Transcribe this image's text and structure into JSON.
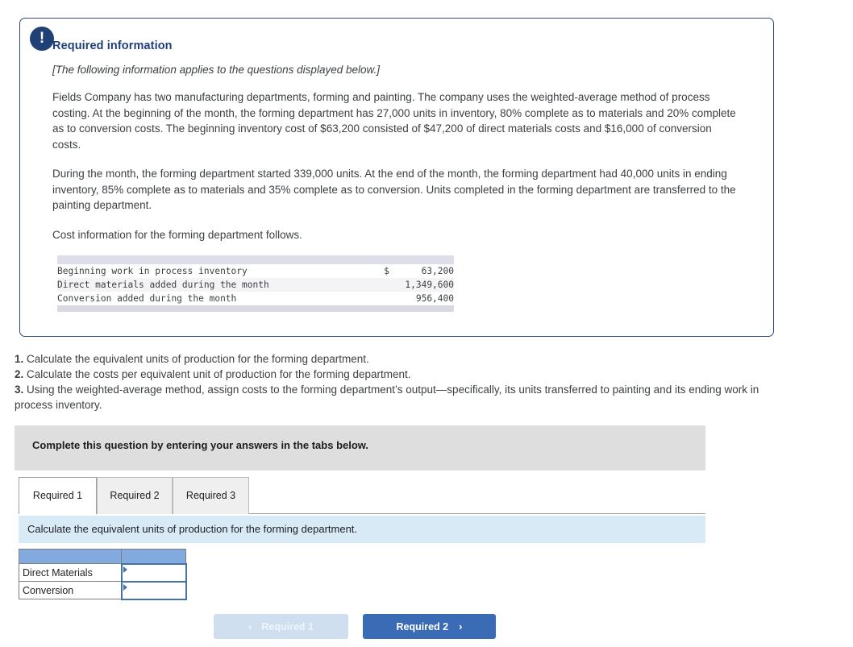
{
  "panel": {
    "alert_icon": "exclamation-icon",
    "alert_glyph": "!",
    "title": "Required information",
    "italic_note": "[The following information applies to the questions displayed below.]",
    "paragraph_1": "Fields Company has two manufacturing departments, forming and painting. The company uses the weighted-average method of process costing. At the beginning of the month, the forming department has 27,000 units in inventory, 80% complete as to materials and 20% complete as to conversion costs. The beginning inventory cost of $63,200 consisted of $47,200 of direct materials costs and $16,000 of conversion costs.",
    "paragraph_2": "During the month, the forming department started 339,000 units. At the end of the month, the forming department had 40,000 units in ending inventory, 85% complete as to materials and 35% complete as to conversion. Units completed in the forming department are transferred to the painting department.",
    "paragraph_3": "Cost information for the forming department follows."
  },
  "cost_table": {
    "rows": [
      {
        "label": "Beginning work in process inventory",
        "currency": "$",
        "amount": "63,200"
      },
      {
        "label": "Direct materials added during the month",
        "currency": "",
        "amount": "1,349,600"
      },
      {
        "label": "Conversion added during the month",
        "currency": "",
        "amount": "956,400"
      }
    ]
  },
  "requirements": [
    {
      "num": "1.",
      "text": " Calculate the equivalent units of production for the forming department."
    },
    {
      "num": "2.",
      "text": " Calculate the costs per equivalent unit of production for the forming department."
    },
    {
      "num": "3.",
      "text": " Using the weighted-average method, assign costs to the forming department’s output—specifically, its units transferred to painting and its ending work in process inventory."
    }
  ],
  "complete_bar": {
    "text": "Complete this question by entering your answers in the tabs below."
  },
  "tabs": [
    {
      "label": "Required 1",
      "active": true
    },
    {
      "label": "Required 2",
      "active": false
    },
    {
      "label": "Required 3",
      "active": false
    }
  ],
  "instruction": {
    "text": "Calculate the equivalent units of production for the forming department."
  },
  "answer_table": {
    "header": [
      "",
      ""
    ],
    "rows": [
      {
        "label": "Direct Materials",
        "value": ""
      },
      {
        "label": "Conversion",
        "value": ""
      }
    ]
  },
  "nav": {
    "prev_label": "Required 1",
    "prev_chevron": "‹",
    "next_label": "Required 2",
    "next_chevron": "›"
  },
  "colors": {
    "panel_border": "#2b4a7d",
    "heading": "#1f3f7a",
    "alert_badge": "#204176",
    "complete_bar": "#dededf",
    "instruction_bar": "#d9eaf7",
    "answer_header": "#82aadf",
    "next_button": "#3a6cb5",
    "prev_button": "#cfdff0"
  }
}
